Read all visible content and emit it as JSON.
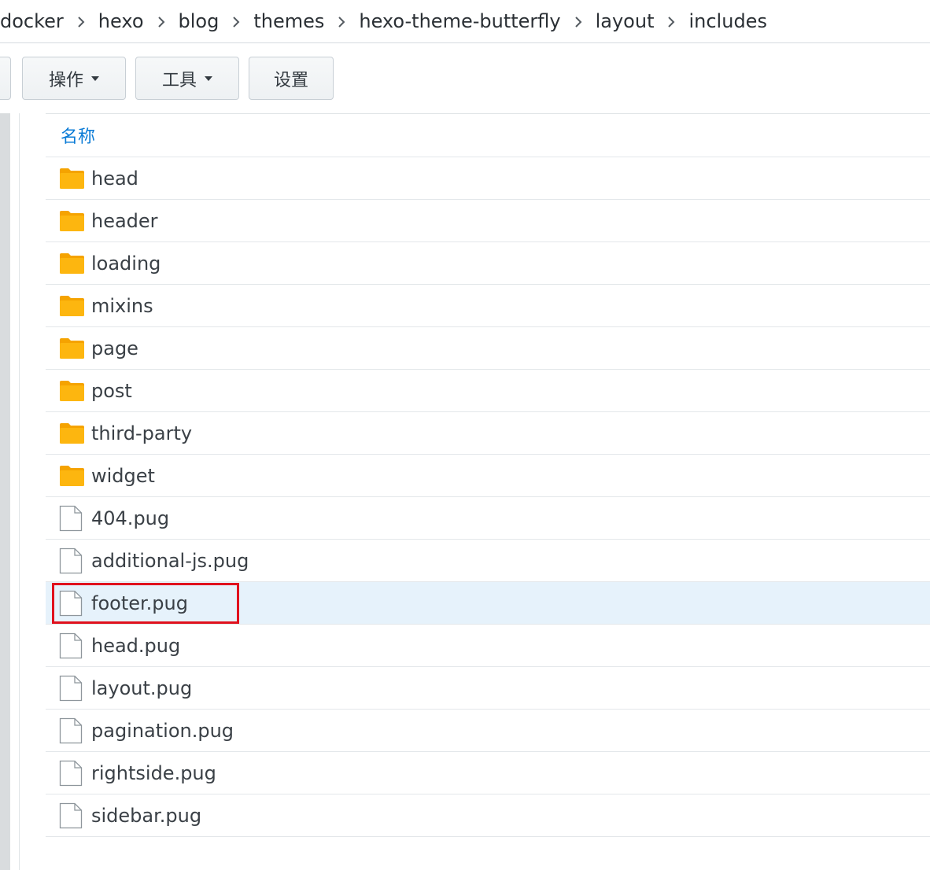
{
  "breadcrumb": [
    "docker",
    "hexo",
    "blog",
    "themes",
    "hexo-theme-butterfly",
    "layout",
    "includes"
  ],
  "toolbar": {
    "action_label": "操作",
    "tools_label": "工具",
    "settings_label": "设置"
  },
  "list": {
    "header_name": "名称",
    "items": [
      {
        "name": "head",
        "type": "folder"
      },
      {
        "name": "header",
        "type": "folder"
      },
      {
        "name": "loading",
        "type": "folder"
      },
      {
        "name": "mixins",
        "type": "folder"
      },
      {
        "name": "page",
        "type": "folder"
      },
      {
        "name": "post",
        "type": "folder"
      },
      {
        "name": "third-party",
        "type": "folder"
      },
      {
        "name": "widget",
        "type": "folder"
      },
      {
        "name": "404.pug",
        "type": "file"
      },
      {
        "name": "additional-js.pug",
        "type": "file"
      },
      {
        "name": "footer.pug",
        "type": "file",
        "selected": true,
        "highlighted": true
      },
      {
        "name": "head.pug",
        "type": "file"
      },
      {
        "name": "layout.pug",
        "type": "file"
      },
      {
        "name": "pagination.pug",
        "type": "file"
      },
      {
        "name": "rightside.pug",
        "type": "file"
      },
      {
        "name": "sidebar.pug",
        "type": "file"
      }
    ]
  },
  "colors": {
    "folder": "#fdb60f",
    "header_text": "#0a7bd6",
    "selected_row": "#e6f2fb",
    "highlight_box": "#e0111d"
  }
}
